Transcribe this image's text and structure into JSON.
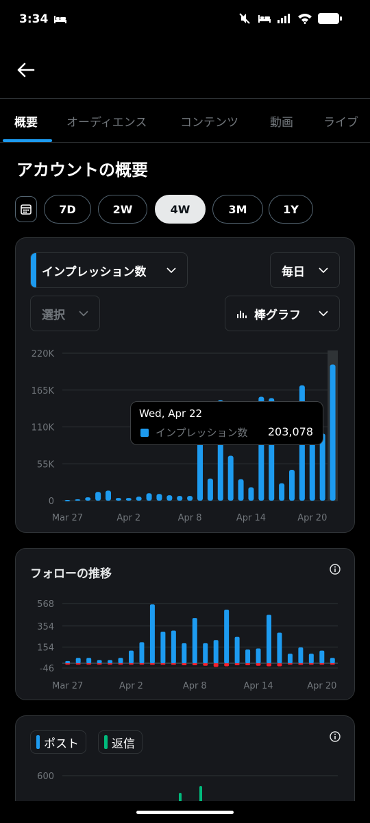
{
  "status_bar": {
    "time": "3:34"
  },
  "tabs": [
    {
      "label": "概要"
    },
    {
      "label": "オーディエンス"
    },
    {
      "label": "コンテンツ"
    },
    {
      "label": "動画"
    },
    {
      "label": "ライブ"
    }
  ],
  "section_title": "アカウントの概要",
  "periods": [
    "7D",
    "2W",
    "4W",
    "3M",
    "1Y"
  ],
  "selected_period": "4W",
  "impressions_card": {
    "metric_dropdown": "インプレッション数",
    "interval_dropdown": "毎日",
    "compare_dropdown": "選択",
    "chart_type_dropdown": "棒グラフ",
    "accent_color": "#1d9bf0",
    "tooltip": {
      "date": "Wed, Apr 22",
      "series": "インプレッション数",
      "value": "203,078"
    }
  },
  "followers_card": {
    "title": "フォローの推移"
  },
  "posts_card": {
    "legend": [
      {
        "label": "ポスト",
        "color": "#1d9bf0"
      },
      {
        "label": "返信",
        "color": "#00ba7c"
      }
    ]
  },
  "chart_data": [
    {
      "type": "bar",
      "title": "",
      "series": [
        {
          "name": "インプレッション数",
          "values": [
            1000,
            2000,
            5000,
            13000,
            15000,
            4000,
            4000,
            6000,
            11000,
            10000,
            8000,
            7000,
            7000,
            140000,
            33000,
            150000,
            67000,
            32000,
            20000,
            155000,
            153000,
            26000,
            46000,
            172000,
            130000,
            100000,
            203078
          ]
        }
      ],
      "x_tick_labels": [
        "Mar 27",
        "Apr 2",
        "Apr 8",
        "Apr 14",
        "Apr 20"
      ],
      "y_tick_labels": [
        "220K",
        "165K",
        "110K",
        "55K",
        "0"
      ],
      "ylim": [
        0,
        220000
      ],
      "highlighted_index": 26,
      "grid": true
    },
    {
      "type": "bar",
      "title": "フォローの推移",
      "series": [
        {
          "name": "",
          "color": "#1d9bf0",
          "values": [
            20,
            50,
            50,
            30,
            30,
            50,
            120,
            200,
            560,
            300,
            310,
            190,
            430,
            190,
            220,
            510,
            250,
            130,
            140,
            460,
            290,
            90,
            150,
            90,
            120,
            50
          ]
        },
        {
          "name": "",
          "color": "#f4212e",
          "values": [
            -5,
            -5,
            -5,
            -5,
            -5,
            -5,
            -5,
            -10,
            -15,
            -15,
            -15,
            -20,
            -20,
            -25,
            -35,
            -30,
            -20,
            -20,
            -25,
            -30,
            -30,
            -10,
            -15,
            -10,
            -10,
            -5
          ]
        }
      ],
      "x_tick_labels": [
        "Mar 27",
        "Apr 2",
        "Apr 8",
        "Apr 14",
        "Apr 20"
      ],
      "y_tick_labels": [
        "568",
        "354",
        "154",
        "-46"
      ],
      "ylim": [
        -46,
        568
      ],
      "grid": true
    },
    {
      "type": "bar",
      "title": "",
      "series": [
        {
          "name": "ポスト",
          "color": "#1d9bf0",
          "values": []
        },
        {
          "name": "返信",
          "color": "#00ba7c",
          "values": []
        }
      ],
      "y_tick_labels": [
        "600"
      ]
    }
  ]
}
